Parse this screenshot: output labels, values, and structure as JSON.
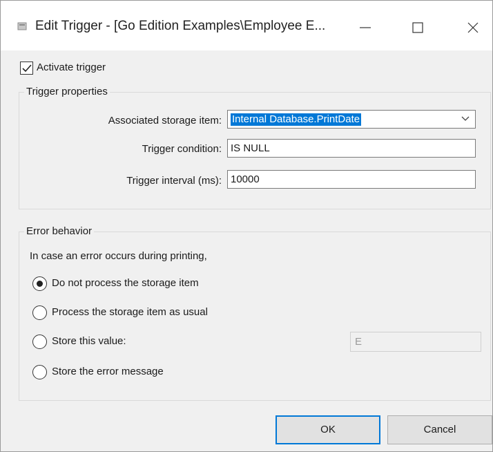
{
  "window": {
    "title": "Edit Trigger - [Go Edition Examples\\Employee E...",
    "controls": [
      "minimize-icon",
      "maximize-icon",
      "close-icon"
    ]
  },
  "activate": {
    "label": "Activate trigger",
    "checked": true
  },
  "trigger_properties": {
    "caption": "Trigger properties",
    "storage_item_label": "Associated storage item:",
    "storage_item_value": "Internal Database.PrintDate",
    "condition_label": "Trigger condition:",
    "condition_value": "IS NULL",
    "interval_label": "Trigger interval (ms):",
    "interval_value": "10000"
  },
  "error_behavior": {
    "caption": "Error behavior",
    "intro": "In case an error occurs during printing,",
    "options": [
      {
        "label": "Do not process the storage item",
        "selected": true
      },
      {
        "label": "Process the storage item as usual",
        "selected": false
      },
      {
        "label": "Store this value:",
        "selected": false
      },
      {
        "label": "Store the error message",
        "selected": false
      }
    ],
    "store_value": "E"
  },
  "buttons": {
    "ok": "OK",
    "cancel": "Cancel"
  },
  "colors": {
    "accent": "#0078d7",
    "dialog_bg": "#f0f0f0"
  }
}
